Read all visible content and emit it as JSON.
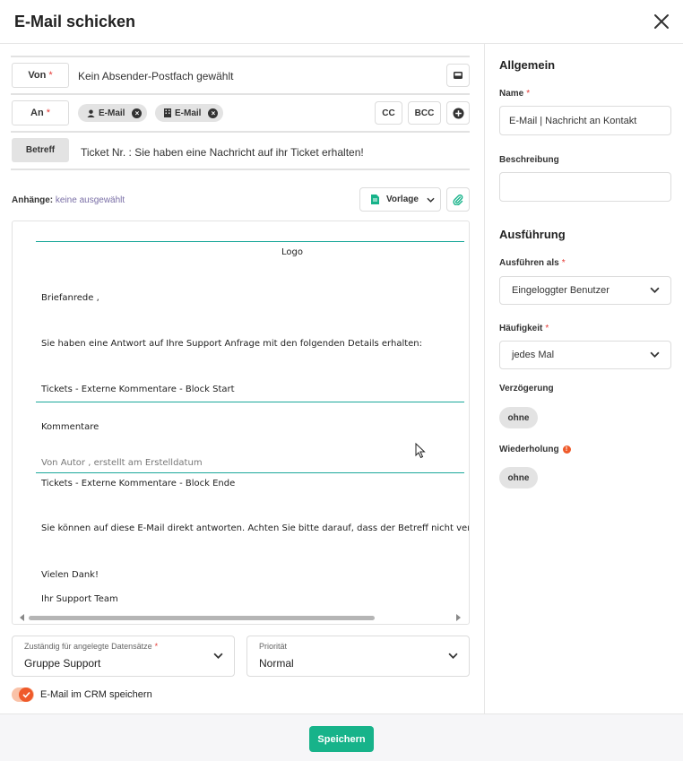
{
  "dialog": {
    "title": "E-Mail schicken"
  },
  "from": {
    "label": "Von",
    "value": "Kein Absender-Postfach gewählt"
  },
  "to": {
    "label": "An",
    "chips": [
      {
        "label": "E-Mail",
        "icon": "person-icon"
      },
      {
        "label": "E-Mail",
        "icon": "building-icon"
      }
    ],
    "cc_label": "CC",
    "bcc_label": "BCC"
  },
  "subject": {
    "label": "Betreff",
    "value": "Ticket Nr. : Sie haben eine Nachricht auf ihr Ticket erhalten!"
  },
  "attachments": {
    "label": "Anhänge:",
    "value": "keine ausgewählt",
    "template_label": "Vorlage"
  },
  "editor": {
    "logo": "Logo",
    "salutation": "Briefanrede ,",
    "intro": "Sie haben eine Antwort auf Ihre Support Anfrage mit den folgenden Details erhalten:",
    "block_start": "Tickets - Externe Kommentare - Block Start",
    "comments": "Kommentare",
    "author_line": "Von Autor , erstellt am Erstelldatum",
    "block_end": "Tickets - Externe Kommentare - Block Ende",
    "reply_note": "Sie können auf diese E-Mail direkt antworten. Achten Sie bitte darauf, dass der Betreff nicht verä",
    "thanks": "Vielen Dank!",
    "signature": "Ihr Support Team"
  },
  "responsible": {
    "label": "Zuständig für angelegte Datensätze",
    "value": "Gruppe Support"
  },
  "priority": {
    "label": "Priorität",
    "value": "Normal"
  },
  "save_in_crm": {
    "label": "E-Mail im CRM speichern",
    "checked": true
  },
  "footer": {
    "save_label": "Speichern"
  },
  "general": {
    "heading": "Allgemein",
    "name_label": "Name",
    "name_value": "E-Mail | Nachricht an Kontakt",
    "description_label": "Beschreibung",
    "description_value": ""
  },
  "execution": {
    "heading": "Ausführung",
    "run_as_label": "Ausführen als",
    "run_as_value": "Eingeloggter Benutzer",
    "frequency_label": "Häufigkeit",
    "frequency_value": "jedes Mal",
    "delay_label": "Verzögerung",
    "delay_value": "ohne",
    "repeat_label": "Wiederholung",
    "repeat_value": "ohne"
  },
  "colors": {
    "accent": "#17b38a",
    "teal_line": "#1aa89a",
    "required": "#e53935",
    "toggle": "#ef5a2a"
  }
}
